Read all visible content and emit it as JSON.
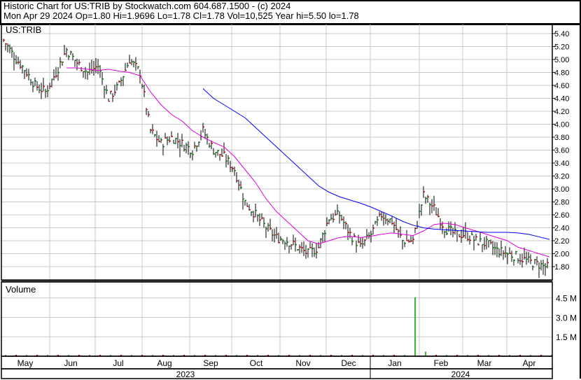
{
  "header": {
    "line1": "Historic Chart  for US:TRIB  by  Stockwatch.com 604.687.1500 - (c) 2024",
    "line2": "Mon  Apr 29 2024   Op=1.80   Hi=1.9696   Lo=1.78   Cl=1.78   Vol=10,525   Year hi=5.50   lo=1.78"
  },
  "chart_data": [
    {
      "type": "line",
      "title": "US:TRIB",
      "x_unit": "trading week index (May 2023 - Apr 2024)",
      "ylim": [
        1.7,
        5.55
      ],
      "yticks": [
        "5.40",
        "5.20",
        "5.00",
        "4.80",
        "4.60",
        "4.40",
        "4.20",
        "4.00",
        "3.80",
        "3.60",
        "3.40",
        "3.20",
        "3.00",
        "2.80",
        "2.60",
        "2.40",
        "2.20",
        "2.00",
        "1.80"
      ],
      "grid": true,
      "close": [
        5.3,
        5.05,
        4.85,
        4.6,
        4.5,
        4.8,
        5.15,
        4.95,
        4.8,
        4.9,
        4.4,
        4.6,
        5.0,
        4.8,
        3.9,
        3.7,
        3.8,
        3.7,
        3.6,
        3.9,
        3.6,
        3.5,
        3.3,
        2.8,
        2.6,
        2.4,
        2.25,
        2.2,
        2.1,
        2.0,
        2.1,
        2.55,
        2.6,
        2.3,
        2.1,
        2.3,
        2.6,
        2.5,
        2.2,
        2.2,
        2.9,
        2.7,
        2.4,
        2.3,
        2.3,
        2.2,
        2.15,
        2.05,
        2.0,
        1.95,
        1.88,
        1.83,
        1.78
      ],
      "series": [
        {
          "name": "short moving average",
          "color": "#e000e0",
          "values": [
            null,
            null,
            null,
            null,
            null,
            null,
            4.87,
            4.87,
            4.85,
            4.83,
            4.85,
            4.82,
            4.8,
            4.75,
            4.5,
            4.3,
            4.15,
            4.05,
            3.9,
            3.8,
            3.72,
            3.65,
            3.5,
            3.3,
            3.1,
            2.85,
            2.65,
            2.5,
            2.35,
            2.2,
            2.15,
            2.2,
            2.25,
            2.27,
            2.25,
            2.27,
            2.3,
            2.32,
            2.3,
            2.28,
            2.35,
            2.45,
            2.47,
            2.45,
            2.4,
            2.35,
            2.3,
            2.25,
            2.2,
            2.1,
            2.05,
            2.0,
            1.95
          ]
        },
        {
          "name": "long moving average",
          "color": "#0000ff",
          "values": [
            null,
            null,
            null,
            null,
            null,
            null,
            null,
            null,
            null,
            null,
            null,
            null,
            null,
            null,
            null,
            null,
            null,
            null,
            null,
            4.55,
            4.4,
            4.3,
            4.2,
            4.1,
            3.95,
            3.8,
            3.65,
            3.5,
            3.35,
            3.2,
            3.05,
            2.95,
            2.88,
            2.83,
            2.78,
            2.72,
            2.65,
            2.58,
            2.5,
            2.44,
            2.4,
            2.38,
            2.37,
            2.36,
            2.35,
            2.34,
            2.33,
            2.33,
            2.33,
            2.32,
            2.3,
            2.26,
            2.22
          ]
        }
      ]
    },
    {
      "type": "bar",
      "title": "Volume",
      "yticks": [
        "4.5 M",
        "3.0 M",
        "1.5 M"
      ],
      "ylim": [
        0,
        5.4
      ],
      "values_millions": [
        0.02,
        0.02,
        0.02,
        0.02,
        0.02,
        0.02,
        0.02,
        0.03,
        0.02,
        0.02,
        0.02,
        0.02,
        0.02,
        0.02,
        0.02,
        0.02,
        0.02,
        0.02,
        0.02,
        0.02,
        0.02,
        0.02,
        0.02,
        0.02,
        0.02,
        0.02,
        0.02,
        0.02,
        0.02,
        0.03,
        0.02,
        0.02,
        0.02,
        0.02,
        0.02,
        0.02,
        0.02,
        0.02,
        0.02,
        4.55,
        0.35,
        0.02,
        0.02,
        0.02,
        0.03,
        0.02,
        0.02,
        0.02,
        0.02,
        0.02,
        0.03,
        0.02,
        0.02
      ]
    }
  ],
  "x_axis": {
    "months": [
      "May",
      "Jun",
      "Jul",
      "Aug",
      "Sep",
      "Oct",
      "Nov",
      "Dec",
      "Jan",
      "Feb",
      "Mar",
      "Apr"
    ],
    "years": [
      "2023",
      "2024"
    ]
  },
  "colors": {
    "up": "#008000",
    "down": "#cc0000",
    "volume_up": "#33bb33",
    "grid": "#c8c8c8"
  }
}
